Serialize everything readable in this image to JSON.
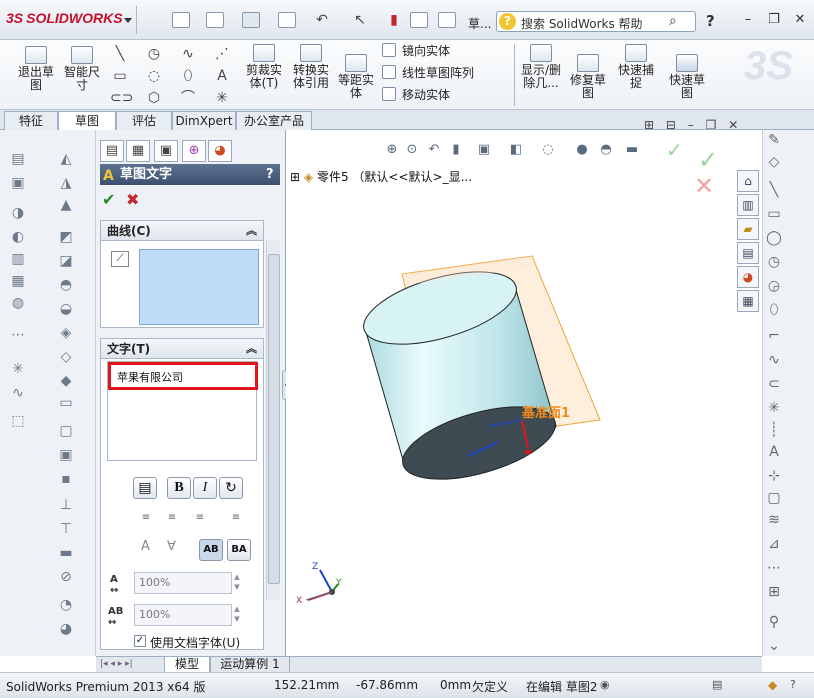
{
  "app": {
    "logo_text": "SOLIDWORKS",
    "logo_mark": "3S",
    "title_fragment": "草...",
    "search_placeholder": "搜索 SolidWorks 帮助",
    "help_label": "?"
  },
  "ribbon": {
    "big_buttons": [
      {
        "label1": "退出草",
        "label2": "图"
      },
      {
        "label1": "智能尺",
        "label2": "寸"
      },
      {
        "label1": "剪裁实",
        "label2": "体(T)"
      },
      {
        "label1": "转换实",
        "label2": "体引用"
      },
      {
        "label1": "等距实",
        "label2": "体"
      },
      {
        "label1": "显示/删",
        "label2": "除几..."
      },
      {
        "label1": "修复草",
        "label2": "图"
      },
      {
        "label1": "快速捕",
        "label2": "捉"
      },
      {
        "label1": "快速草",
        "label2": "图"
      }
    ],
    "small_buttons": [
      "镜向实体",
      "线性草图阵列",
      "移动实体"
    ]
  },
  "tabs": [
    "特征",
    "草图",
    "评估",
    "DimXpert",
    "办公室产品"
  ],
  "active_tab": "草图",
  "property_manager": {
    "title": "草图文字",
    "help": "?",
    "curves_group": "曲线(C)",
    "text_group": "文字(T)",
    "text_value": "苹果有限公司",
    "bold_label": "B",
    "italic_label": "I",
    "width_factor": "100%",
    "spacing": "100%",
    "use_doc_font_label": "使用文档字体(U)",
    "use_doc_font_checked": true
  },
  "tree": {
    "root_label": "零件5 （默认<<默认>_显..."
  },
  "viewport": {
    "plane_label": "基准面1",
    "triad": {
      "x": "X",
      "y": "Y",
      "z": "Z"
    }
  },
  "bottom_tabs": [
    "模型",
    "运动算例 1"
  ],
  "active_bottom_tab": "模型",
  "status": {
    "product": "SolidWorks Premium 2013 x64 版",
    "x": "152.21mm",
    "y": "-67.86mm",
    "z": "0mm",
    "state": "欠定义",
    "mode": "在编辑 草图2"
  },
  "colors": {
    "accent_red": "#e3141c",
    "cylinder": "#cfeff2",
    "plane_fill": "#fde9d2",
    "plane_stroke": "#f0a33a",
    "plane_label": "#f08a1c",
    "pm_header": "#3d5070"
  }
}
